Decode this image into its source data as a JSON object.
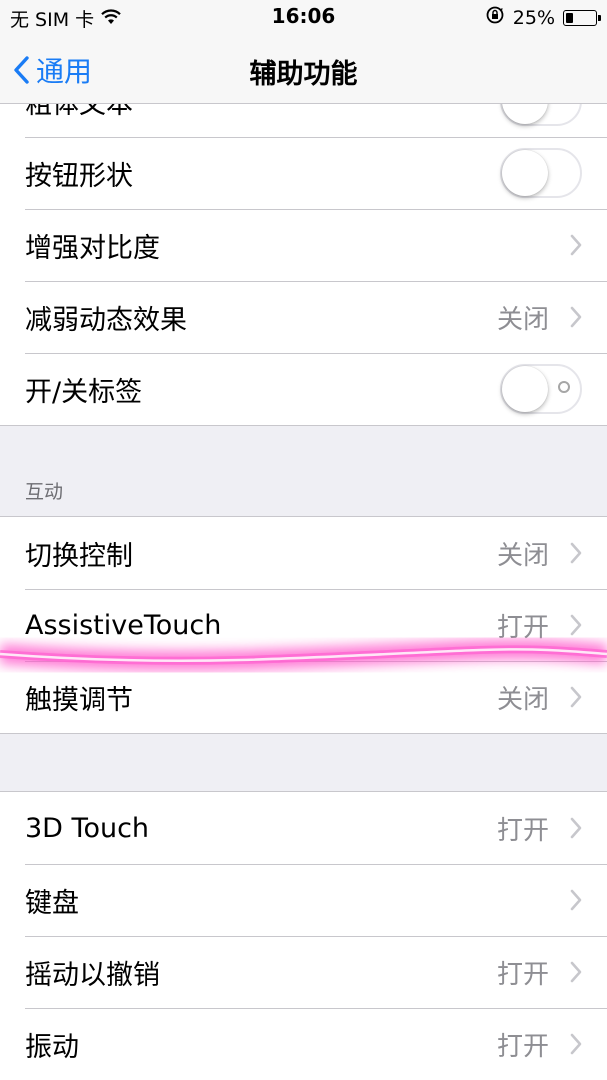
{
  "status_bar": {
    "carrier": "无 SIM 卡",
    "time": "16:06",
    "battery": "25%",
    "battery_level": 0.25
  },
  "nav": {
    "back_label": "通用",
    "title": "辅助功能"
  },
  "group1": [
    {
      "label": "粗体文本",
      "type": "toggle",
      "on": false
    },
    {
      "label": "按钮形状",
      "type": "toggle",
      "on": false
    },
    {
      "label": "增强对比度",
      "type": "chevron",
      "value": ""
    },
    {
      "label": "减弱动态效果",
      "type": "chevron",
      "value": "关闭"
    },
    {
      "label": "开/关标签",
      "type": "toggle",
      "on": false
    }
  ],
  "section_interaction": {
    "title": "互动",
    "items": [
      {
        "label": "切换控制",
        "value": "关闭"
      },
      {
        "label": "AssistiveTouch",
        "value": "打开"
      },
      {
        "label": "触摸调节",
        "value": "关闭"
      }
    ]
  },
  "group3": [
    {
      "label": "3D Touch",
      "value": "打开"
    },
    {
      "label": "键盘",
      "value": ""
    },
    {
      "label": "摇动以撤销",
      "value": "打开"
    },
    {
      "label": "振动",
      "value": "打开"
    }
  ],
  "colors": {
    "accent": "#1a7cf5",
    "highlight": "#ff4fc8",
    "secondary_text": "#8e8e93",
    "background": "#efeff4"
  }
}
